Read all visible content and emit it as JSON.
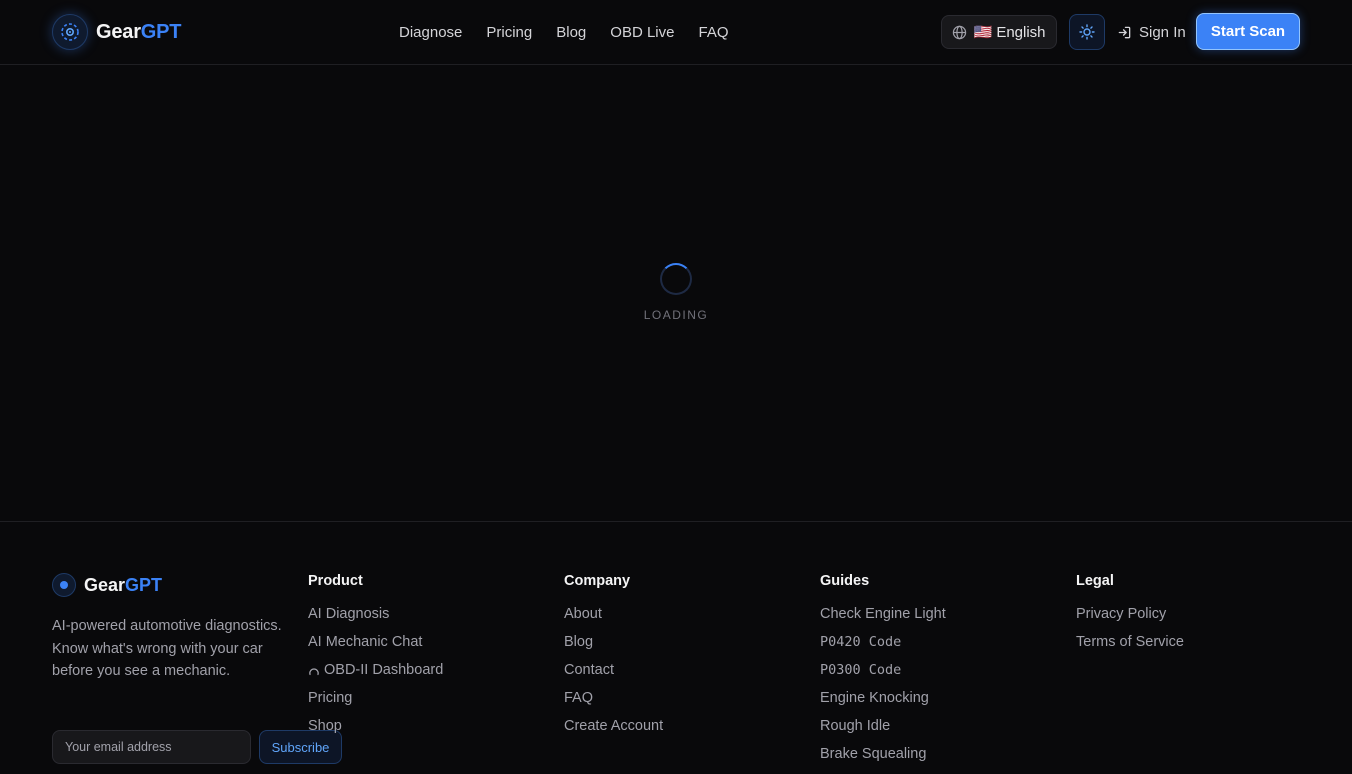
{
  "header": {
    "brand": {
      "name_main": "Gear",
      "name_accent": "GPT"
    },
    "nav": [
      "Diagnose",
      "Pricing",
      "Blog",
      "OBD Live",
      "FAQ"
    ],
    "language": "🇺🇸 English",
    "sign_in": "Sign In",
    "start_scan": "Start Scan"
  },
  "loading": {
    "text": "LOADING"
  },
  "footer": {
    "brand": {
      "name_main": "Gear",
      "name_accent": "GPT"
    },
    "tagline": "AI-powered automotive diagnostics. Know what's wrong with your car before you see a mechanic.",
    "email_placeholder": "Your email address",
    "subscribe": "Subscribe",
    "columns": {
      "product": {
        "title": "Product",
        "items": [
          "AI Diagnosis",
          "AI Mechanic Chat",
          "OBD-II Dashboard",
          "Pricing",
          "Shop"
        ]
      },
      "company": {
        "title": "Company",
        "items": [
          "About",
          "Blog",
          "Contact",
          "FAQ",
          "Create Account"
        ]
      },
      "guides": {
        "title": "Guides",
        "items": [
          "Check Engine Light",
          "P0420 Code",
          "P0300 Code",
          "Engine Knocking",
          "Rough Idle",
          "Brake Squealing"
        ]
      },
      "legal": {
        "title": "Legal",
        "items": [
          "Privacy Policy",
          "Terms of Service"
        ]
      }
    }
  },
  "colors": {
    "background": "#09090b",
    "accent": "#3b82f6",
    "text_muted": "#a1a1aa"
  },
  "icons": [
    "gear-logo-icon",
    "globe-icon",
    "sun-icon",
    "sign-in-icon",
    "loading-spinner",
    "gauge-icon"
  ]
}
